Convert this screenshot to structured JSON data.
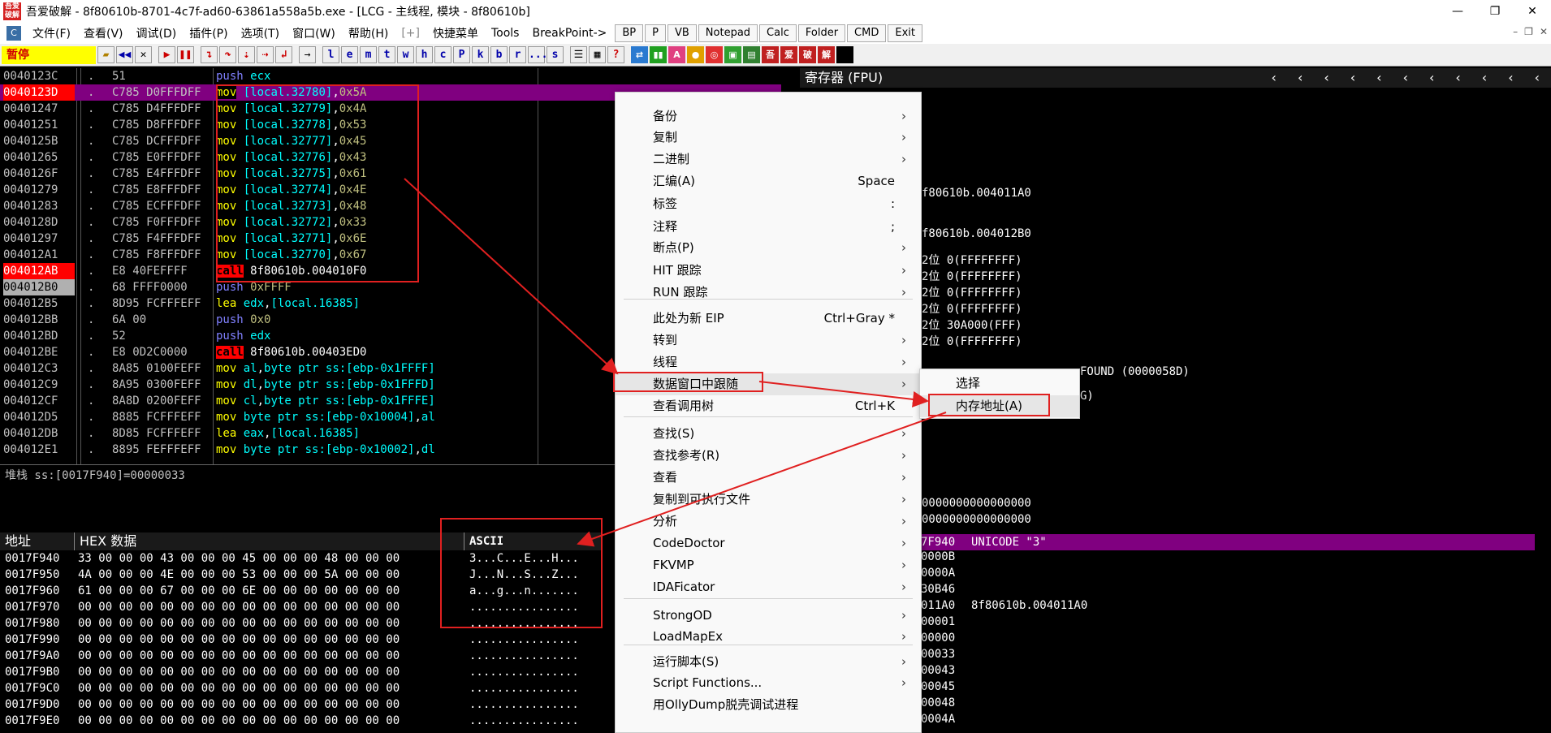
{
  "window": {
    "title": "吾爱破解 - 8f80610b-8701-4c7f-ad60-63861a558a5b.exe - [LCG - 主线程, 模块 - 8f80610b]",
    "app_icon_text": "吾爱破解",
    "controls": [
      "—",
      "❐",
      "✕"
    ]
  },
  "menubar": {
    "items": [
      "文件(F)",
      "查看(V)",
      "调试(D)",
      "插件(P)",
      "选项(T)",
      "窗口(W)",
      "帮助(H)",
      "[+]",
      "快捷菜单",
      "Tools",
      "BreakPoint->"
    ],
    "buttons": [
      "BP",
      "P",
      "VB",
      "Notepad",
      "Calc",
      "Folder",
      "CMD",
      "Exit"
    ],
    "mdi_controls": [
      "–",
      "❐",
      "✕"
    ]
  },
  "toolbar": {
    "status": "暂停",
    "letter_buttons": [
      "l",
      "e",
      "m",
      "t",
      "w",
      "h",
      "c",
      "P",
      "k",
      "b",
      "r",
      "...",
      "s"
    ],
    "plugin_icons": [
      "吾",
      "爱",
      "破",
      "解"
    ]
  },
  "disasm": {
    "rows": [
      {
        "addr": "0040123C",
        "mark": ".",
        "hex": "51",
        "op": "push",
        "args": [
          {
            "t": "reg",
            "v": "ecx"
          }
        ]
      },
      {
        "addr": "0040123D",
        "mark": ".",
        "hex": "C785 D0FFFDFF",
        "op": "mov",
        "args": [
          {
            "t": "mem",
            "v": "[local.32780]"
          },
          {
            "t": "sep",
            "v": ","
          },
          {
            "t": "imm",
            "v": "0x5A"
          }
        ]
      },
      {
        "addr": "00401247",
        "mark": ".",
        "hex": "C785 D4FFFDFF",
        "op": "mov",
        "args": [
          {
            "t": "mem",
            "v": "[local.32779]"
          },
          {
            "t": "sep",
            "v": ","
          },
          {
            "t": "imm",
            "v": "0x4A"
          }
        ]
      },
      {
        "addr": "00401251",
        "mark": ".",
        "hex": "C785 D8FFFDFF",
        "op": "mov",
        "args": [
          {
            "t": "mem",
            "v": "[local.32778]"
          },
          {
            "t": "sep",
            "v": ","
          },
          {
            "t": "imm",
            "v": "0x53"
          }
        ]
      },
      {
        "addr": "0040125B",
        "mark": ".",
        "hex": "C785 DCFFFDFF",
        "op": "mov",
        "args": [
          {
            "t": "mem",
            "v": "[local.32777]"
          },
          {
            "t": "sep",
            "v": ","
          },
          {
            "t": "imm",
            "v": "0x45"
          }
        ]
      },
      {
        "addr": "00401265",
        "mark": ".",
        "hex": "C785 E0FFFDFF",
        "op": "mov",
        "args": [
          {
            "t": "mem",
            "v": "[local.32776]"
          },
          {
            "t": "sep",
            "v": ","
          },
          {
            "t": "imm",
            "v": "0x43"
          }
        ]
      },
      {
        "addr": "0040126F",
        "mark": ".",
        "hex": "C785 E4FFFDFF",
        "op": "mov",
        "args": [
          {
            "t": "mem",
            "v": "[local.32775]"
          },
          {
            "t": "sep",
            "v": ","
          },
          {
            "t": "imm",
            "v": "0x61"
          }
        ]
      },
      {
        "addr": "00401279",
        "mark": ".",
        "hex": "C785 E8FFFDFF",
        "op": "mov",
        "args": [
          {
            "t": "mem",
            "v": "[local.32774]"
          },
          {
            "t": "sep",
            "v": ","
          },
          {
            "t": "imm",
            "v": "0x4E"
          }
        ]
      },
      {
        "addr": "00401283",
        "mark": ".",
        "hex": "C785 ECFFFDFF",
        "op": "mov",
        "args": [
          {
            "t": "mem",
            "v": "[local.32773]"
          },
          {
            "t": "sep",
            "v": ","
          },
          {
            "t": "imm",
            "v": "0x48"
          }
        ]
      },
      {
        "addr": "0040128D",
        "mark": ".",
        "hex": "C785 F0FFFDFF",
        "op": "mov",
        "args": [
          {
            "t": "mem",
            "v": "[local.32772]"
          },
          {
            "t": "sep",
            "v": ","
          },
          {
            "t": "imm",
            "v": "0x33"
          }
        ]
      },
      {
        "addr": "00401297",
        "mark": ".",
        "hex": "C785 F4FFFDFF",
        "op": "mov",
        "args": [
          {
            "t": "mem",
            "v": "[local.32771]"
          },
          {
            "t": "sep",
            "v": ","
          },
          {
            "t": "imm",
            "v": "0x6E"
          }
        ]
      },
      {
        "addr": "004012A1",
        "mark": ".",
        "hex": "C785 F8FFFDFF",
        "op": "mov",
        "args": [
          {
            "t": "mem",
            "v": "[local.32770]"
          },
          {
            "t": "sep",
            "v": ","
          },
          {
            "t": "imm",
            "v": "0x67"
          }
        ]
      },
      {
        "addr": "004012AB",
        "mark": ".",
        "hex": "E8 40FEFFFF",
        "op": "call",
        "args": [
          {
            "t": "text",
            "v": "8f80610b.004010F0"
          }
        ]
      },
      {
        "addr": "004012B0",
        "mark": ".",
        "hex": "68 FFFF0000",
        "op": "push",
        "args": [
          {
            "t": "imm",
            "v": "0xFFFF"
          }
        ]
      },
      {
        "addr": "004012B5",
        "mark": ".",
        "hex": "8D95 FCFFFEFF",
        "op": "lea",
        "args": [
          {
            "t": "reg",
            "v": "edx"
          },
          {
            "t": "sep",
            "v": ","
          },
          {
            "t": "mem",
            "v": "[local.16385]"
          }
        ]
      },
      {
        "addr": "004012BB",
        "mark": ".",
        "hex": "6A 00",
        "op": "push",
        "args": [
          {
            "t": "imm",
            "v": "0x0"
          }
        ]
      },
      {
        "addr": "004012BD",
        "mark": ".",
        "hex": "52",
        "op": "push",
        "args": [
          {
            "t": "reg",
            "v": "edx"
          }
        ]
      },
      {
        "addr": "004012BE",
        "mark": ".",
        "hex": "E8 0D2C0000",
        "op": "call",
        "args": [
          {
            "t": "text",
            "v": "8f80610b.00403ED0"
          }
        ]
      },
      {
        "addr": "004012C3",
        "mark": ".",
        "hex": "8A85 0100FEFF",
        "op": "mov",
        "args": [
          {
            "t": "reg",
            "v": "al"
          },
          {
            "t": "sep",
            "v": ","
          },
          {
            "t": "mem",
            "v": "byte ptr ss:[ebp-0x1FFFF]"
          }
        ]
      },
      {
        "addr": "004012C9",
        "mark": ".",
        "hex": "8A95 0300FEFF",
        "op": "mov",
        "args": [
          {
            "t": "reg",
            "v": "dl"
          },
          {
            "t": "sep",
            "v": ","
          },
          {
            "t": "mem",
            "v": "byte ptr ss:[ebp-0x1FFFD]"
          }
        ]
      },
      {
        "addr": "004012CF",
        "mark": ".",
        "hex": "8A8D 0200FEFF",
        "op": "mov",
        "args": [
          {
            "t": "reg",
            "v": "cl"
          },
          {
            "t": "sep",
            "v": ","
          },
          {
            "t": "mem",
            "v": "byte ptr ss:[ebp-0x1FFFE]"
          }
        ]
      },
      {
        "addr": "004012D5",
        "mark": ".",
        "hex": "8885 FCFFFEFF",
        "op": "mov",
        "args": [
          {
            "t": "mem",
            "v": "byte ptr ss:[ebp-0x10004]"
          },
          {
            "t": "sep",
            "v": ","
          },
          {
            "t": "reg",
            "v": "al"
          }
        ]
      },
      {
        "addr": "004012DB",
        "mark": ".",
        "hex": "8D85 FCFFFEFF",
        "op": "lea",
        "args": [
          {
            "t": "reg",
            "v": "eax"
          },
          {
            "t": "sep",
            "v": ","
          },
          {
            "t": "mem",
            "v": "[local.16385]"
          }
        ]
      },
      {
        "addr": "004012E1",
        "mark": ".",
        "hex": "8895 FEFFFEFF",
        "op": "mov",
        "args": [
          {
            "t": "mem",
            "v": "byte ptr ss:[ebp-0x10002]"
          },
          {
            "t": "sep",
            "v": ","
          },
          {
            "t": "reg",
            "v": "dl"
          }
        ]
      }
    ],
    "selected_index": 1,
    "red_addr_index": [
      1,
      12
    ],
    "gray_addr_index": [
      13
    ]
  },
  "infoline": "堆栈 ss:[0017F940]=00000033",
  "dump": {
    "headers": [
      "地址",
      "HEX 数据",
      "ASCII"
    ],
    "rows": [
      {
        "addr": "0017F940",
        "hex": "33 00 00 00 43 00 00 00 45 00 00 00 48 00 00 00",
        "ascii": "3...C...E...H..."
      },
      {
        "addr": "0017F950",
        "hex": "4A 00 00 00 4E 00 00 00 53 00 00 00 5A 00 00 00",
        "ascii": "J...N...S...Z..."
      },
      {
        "addr": "0017F960",
        "hex": "61 00 00 00 67 00 00 00 6E 00 00 00 00 00 00 00",
        "ascii": "a...g...n......."
      },
      {
        "addr": "0017F970",
        "hex": "00 00 00 00 00 00 00 00 00 00 00 00 00 00 00 00",
        "ascii": "................"
      },
      {
        "addr": "0017F980",
        "hex": "00 00 00 00 00 00 00 00 00 00 00 00 00 00 00 00",
        "ascii": "................"
      },
      {
        "addr": "0017F990",
        "hex": "00 00 00 00 00 00 00 00 00 00 00 00 00 00 00 00",
        "ascii": "................"
      },
      {
        "addr": "0017F9A0",
        "hex": "00 00 00 00 00 00 00 00 00 00 00 00 00 00 00 00",
        "ascii": "................"
      },
      {
        "addr": "0017F9B0",
        "hex": "00 00 00 00 00 00 00 00 00 00 00 00 00 00 00 00",
        "ascii": "................"
      },
      {
        "addr": "0017F9C0",
        "hex": "00 00 00 00 00 00 00 00 00 00 00 00 00 00 00 00",
        "ascii": "................"
      },
      {
        "addr": "0017F9D0",
        "hex": "00 00 00 00 00 00 00 00 00 00 00 00 00 00 00 00",
        "ascii": "................"
      },
      {
        "addr": "0017F9E0",
        "hex": "00 00 00 00 00 00 00 00 00 00 00 00 00 00 00 00",
        "ascii": "................"
      }
    ]
  },
  "registers": {
    "header": "寄存器 (FPU)",
    "lines": [
      "f80610b.004011A0",
      "f80610b.004012B0",
      "2位 0(FFFFFFFF)",
      "2位 0(FFFFFFFF)",
      "2位 0(FFFFFFFF)",
      "2位 0(FFFFFFFF)",
      "2位 30A000(FFF)",
      "2位 0(FFFFFFFF)",
      "FOUND (0000058D)",
      "G)",
      "0000000000000000",
      "0000000000000000"
    ]
  },
  "stack": {
    "header_addr": "7F940",
    "header_value": "UNICODE \"3\"",
    "lines": [
      "0000B",
      "0000A",
      "30B46",
      "011A0",
      "00001",
      "00000",
      "00033",
      "00043",
      "00045",
      "00048",
      "0004A"
    ],
    "comment": "8f80610b.004011A0"
  },
  "context_menu": {
    "items": [
      {
        "label": "备份",
        "shortcut": "",
        "submenu": true
      },
      {
        "label": "复制",
        "shortcut": "",
        "submenu": true
      },
      {
        "label": "二进制",
        "shortcut": "",
        "submenu": true
      },
      {
        "label": "汇编(A)",
        "shortcut": "Space",
        "submenu": false
      },
      {
        "label": "标签",
        "shortcut": ":",
        "submenu": false
      },
      {
        "label": "注释",
        "shortcut": ";",
        "submenu": false
      },
      {
        "label": "断点(P)",
        "shortcut": "",
        "submenu": true
      },
      {
        "label": "HIT 跟踪",
        "shortcut": "",
        "submenu": true
      },
      {
        "label": "RUN 跟踪",
        "shortcut": "",
        "submenu": true
      },
      {
        "label": "此处为新 EIP",
        "shortcut": "Ctrl+Gray *",
        "submenu": false
      },
      {
        "label": "转到",
        "shortcut": "",
        "submenu": true
      },
      {
        "label": "线程",
        "shortcut": "",
        "submenu": true
      },
      {
        "label": "数据窗口中跟随",
        "shortcut": "",
        "submenu": true
      },
      {
        "label": "查看调用树",
        "shortcut": "Ctrl+K",
        "submenu": false
      },
      {
        "label": "查找(S)",
        "shortcut": "",
        "submenu": true
      },
      {
        "label": "查找参考(R)",
        "shortcut": "",
        "submenu": true
      },
      {
        "label": "查看",
        "shortcut": "",
        "submenu": true
      },
      {
        "label": "复制到可执行文件",
        "shortcut": "",
        "submenu": true
      },
      {
        "label": "分析",
        "shortcut": "",
        "submenu": true
      },
      {
        "label": "CodeDoctor",
        "shortcut": "",
        "submenu": true
      },
      {
        "label": "FKVMP",
        "shortcut": "",
        "submenu": true
      },
      {
        "label": "IDAFicator",
        "shortcut": "",
        "submenu": true
      },
      {
        "label": "StrongOD",
        "shortcut": "",
        "submenu": true
      },
      {
        "label": "LoadMapEx",
        "shortcut": "",
        "submenu": true
      },
      {
        "label": "运行脚本(S)",
        "shortcut": "",
        "submenu": true
      },
      {
        "label": "Script Functions...",
        "shortcut": "",
        "submenu": true
      },
      {
        "label": "用OllyDump脱壳调试进程",
        "shortcut": "",
        "submenu": false
      }
    ],
    "hover_index": 12
  },
  "submenu": {
    "items": [
      "选择",
      "内存地址(A)"
    ],
    "hover_index": 1
  },
  "colors": {
    "annotation": "#e02020",
    "selection": "#800080",
    "status_bg": "#ffff00"
  }
}
